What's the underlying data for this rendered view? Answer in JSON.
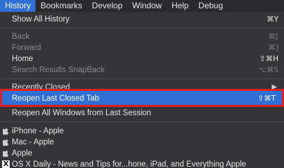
{
  "menubar": {
    "items": [
      "History",
      "Bookmarks",
      "Develop",
      "Window",
      "Help",
      "Debug"
    ]
  },
  "menu": {
    "show_all_history": {
      "label": "Show All History",
      "shortcut": "⌘Y"
    },
    "back": {
      "label": "Back",
      "shortcut": "⌘["
    },
    "forward": {
      "label": "Forward",
      "shortcut": "⌘]"
    },
    "home": {
      "label": "Home",
      "shortcut": "⇧⌘H"
    },
    "search_results_snapback": {
      "label": "Search Results SnapBack",
      "shortcut": "⌥⌘S"
    },
    "recently_closed": {
      "label": "Recently Closed"
    },
    "reopen_last_closed_tab": {
      "label": "Reopen Last Closed Tab",
      "shortcut": "⇧⌘T"
    },
    "reopen_all_windows": {
      "label": "Reopen All Windows from Last Session"
    },
    "history_items": [
      {
        "label": "iPhone - Apple",
        "icon": "apple-icon"
      },
      {
        "label": "Mac - Apple",
        "icon": "apple-icon"
      },
      {
        "label": "Apple",
        "icon": "apple-icon"
      },
      {
        "label": "OS X Daily - News and Tips for...hone, iPad, and Everything Apple",
        "icon": "osxdaily-icon"
      }
    ]
  },
  "colors": {
    "menu_background": "#353537",
    "selection": "#2f6fd6",
    "annotation_border": "#e02020"
  }
}
